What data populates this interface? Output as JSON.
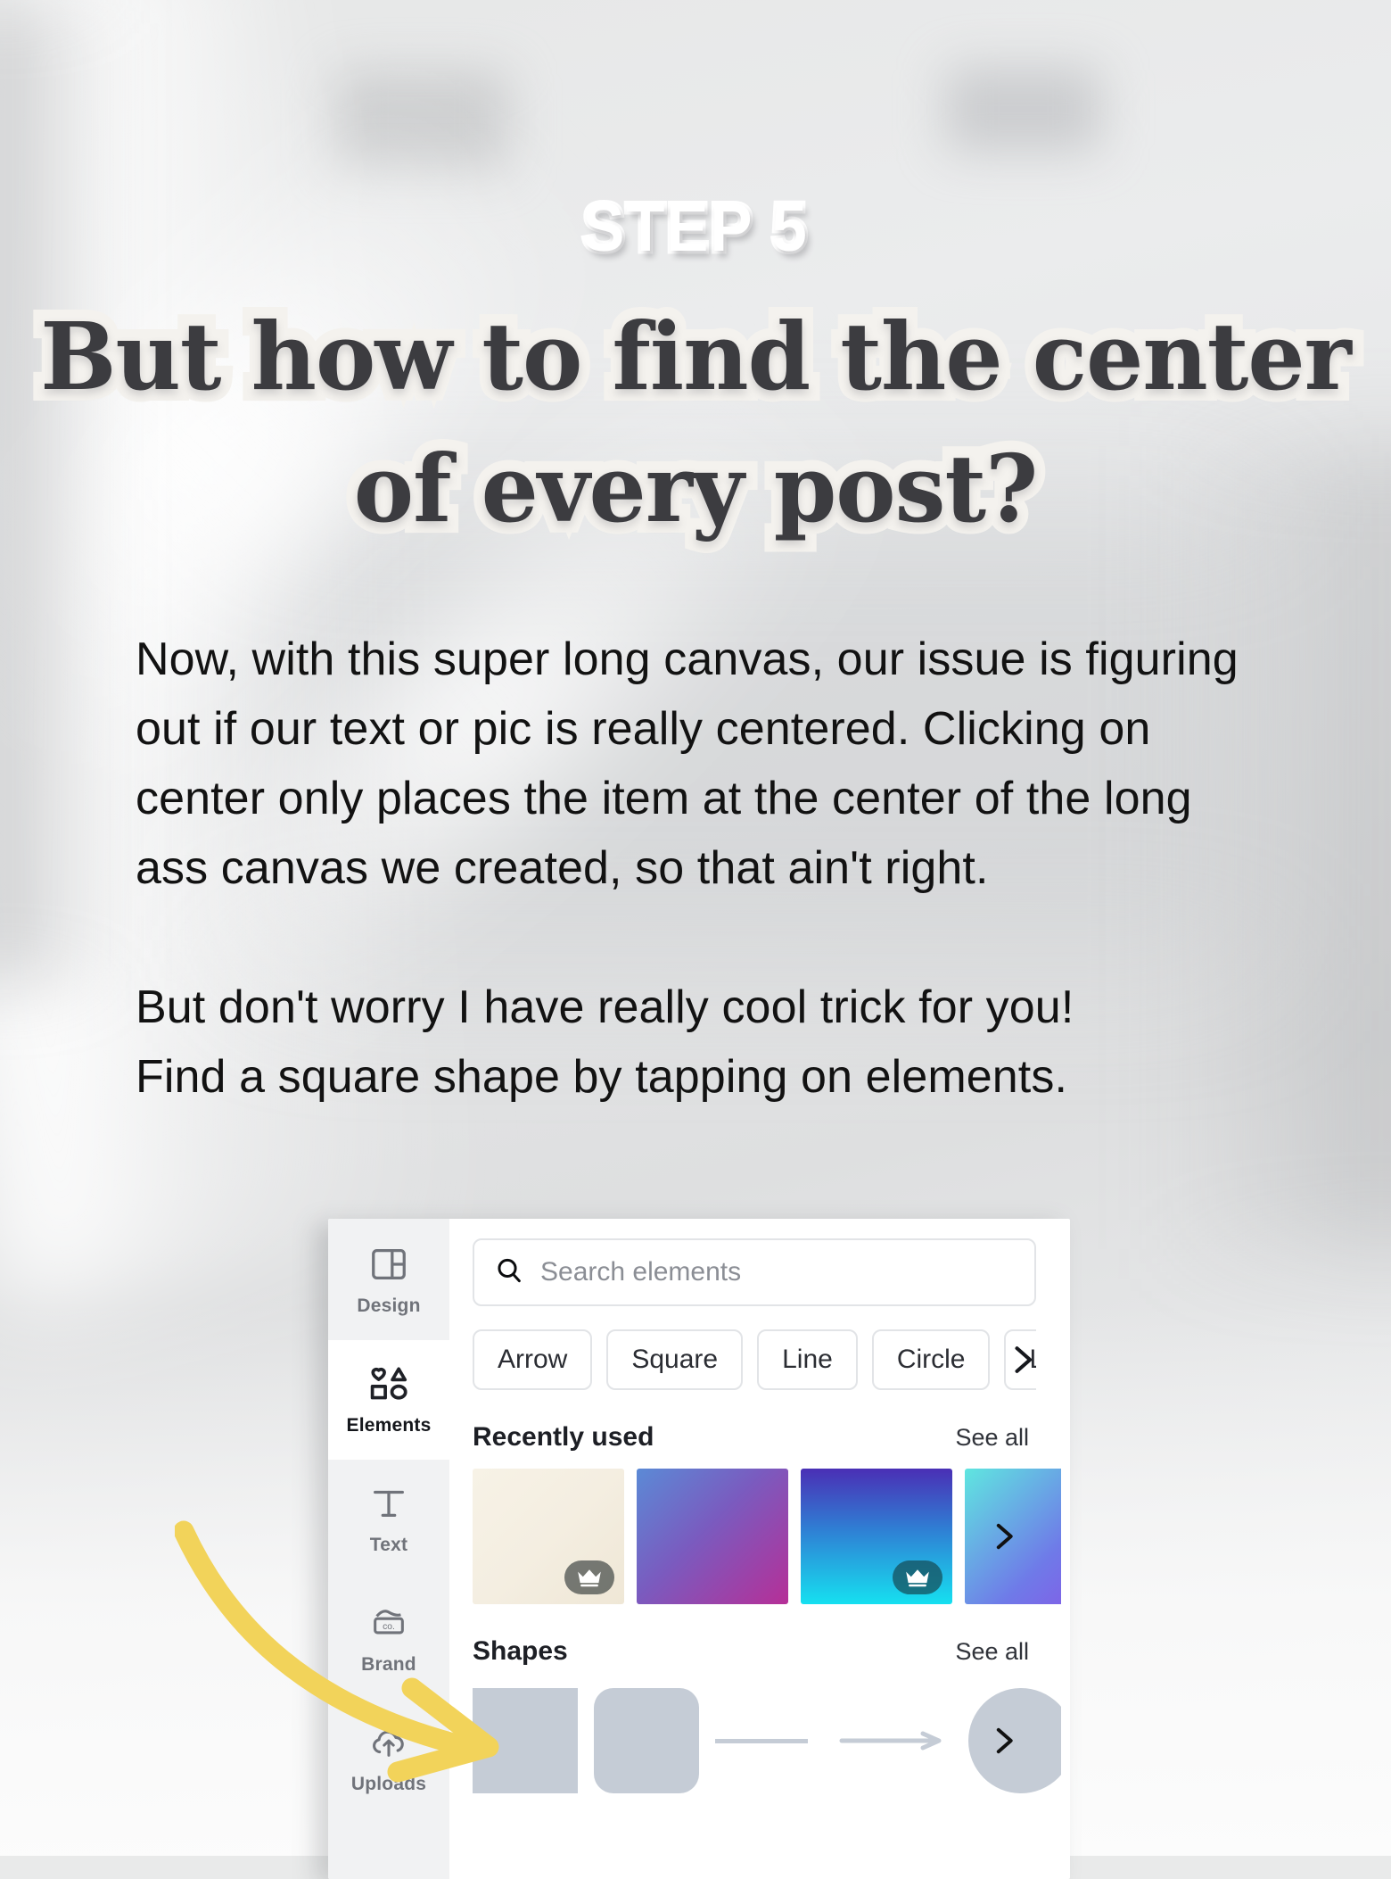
{
  "slide": {
    "step_label": "STEP 5",
    "headline_lines": [
      "But how to find the center",
      "of every post?"
    ],
    "body_paragraphs": [
      "Now, with this super long canvas, our issue is figuring out if our text or pic is really centered. Clicking on center only places the item at the center of the long ass canvas we created, so that ain't right.",
      "But don't worry I have really cool trick for you!\nFind a square shape by tapping on elements."
    ],
    "body_lines_1": [
      "Now, with this super long canvas, our issue is figuring",
      "out if our text or pic is really centered. Clicking on",
      "center only places the item at the center of the long",
      "ass canvas we created, so that ain't right."
    ],
    "body_lines_2": [
      "But don't worry I have really cool trick for you!",
      "Find a square shape by tapping on elements."
    ]
  },
  "colors": {
    "headline_fill": "#3c3c40",
    "headline_outline": "#f4f2ee",
    "step_fill": "#ffffff",
    "body_text": "#121212",
    "arrow_yellow": "#f2d35a",
    "shape_grey": "#c5ccd6",
    "panel_bg": "#ffffff",
    "sidebar_bg": "#f1f2f3"
  },
  "canva": {
    "sidebar": [
      {
        "label": "Design",
        "icon": "layout-icon",
        "active": false
      },
      {
        "label": "Elements",
        "icon": "shapes-icon",
        "active": true
      },
      {
        "label": "Text",
        "icon": "text-t-icon",
        "active": false
      },
      {
        "label": "Brand",
        "icon": "brand-co-icon",
        "active": false
      },
      {
        "label": "Uploads",
        "icon": "upload-cloud-icon",
        "active": false
      }
    ],
    "search": {
      "placeholder": "Search elements",
      "value": "",
      "icon": "search-icon"
    },
    "chips": [
      {
        "label": "Arrow"
      },
      {
        "label": "Square"
      },
      {
        "label": "Line"
      },
      {
        "label": "Circle"
      },
      {
        "label": "Le"
      }
    ],
    "chip_scroll_icon": "chevron-right-icon",
    "sections": [
      {
        "title": "Recently used",
        "see_all": "See all",
        "thumbs": [
          {
            "name": "cream-texture-thumb",
            "gradient": "linear-gradient(135deg,#f7f2e6 0%,#f4eee1 50%,#efe7d6 100%)",
            "premium": true
          },
          {
            "name": "blue-magenta-thumb",
            "gradient": "linear-gradient(135deg,#5b8ad6 0%,#7a5bbf 45%,#b62f97 100%)",
            "premium": false
          },
          {
            "name": "violet-cyan-thumb",
            "gradient": "linear-gradient(180deg,#4a2fb5 0%,#2f7fd4 45%,#16e0f0 100%)",
            "premium": true
          },
          {
            "name": "cyan-violet-thumb",
            "gradient": "linear-gradient(135deg,#5fe6e0 0%,#6f7ae8 60%,#8a52e6 100%)",
            "premium": false
          }
        ]
      },
      {
        "title": "Shapes",
        "see_all": "See all",
        "shapes": [
          {
            "name": "square-shape"
          },
          {
            "name": "rounded-square-shape"
          },
          {
            "name": "line-shape"
          },
          {
            "name": "arrow-shape"
          },
          {
            "name": "circle-shape"
          }
        ]
      }
    ]
  },
  "annotation": {
    "arrow_name": "yellow-pointer-arrow",
    "points_to": "square-shape"
  }
}
